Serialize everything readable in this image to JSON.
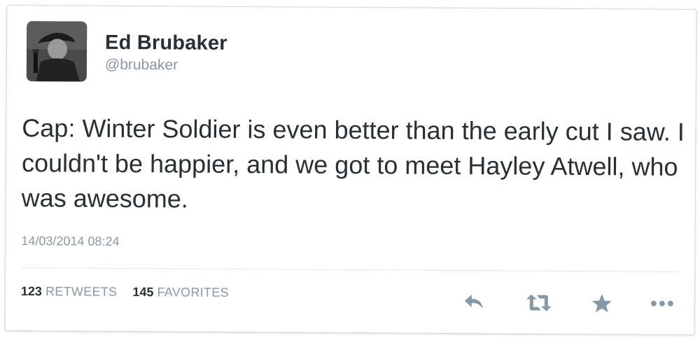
{
  "tweet": {
    "author": {
      "display_name": "Ed Brubaker",
      "handle": "@brubaker"
    },
    "text": "Cap: Winter Soldier is even better than the early cut I saw. I couldn't be happier, and we got to meet Hayley Atwell, who was awesome.",
    "timestamp": "14/03/2014 08:24",
    "stats": {
      "retweets_count": "123",
      "retweets_label": "RETWEETS",
      "favorites_count": "145",
      "favorites_label": "FAVORITES"
    },
    "actions": {
      "reply_icon": "reply-icon",
      "retweet_icon": "retweet-icon",
      "favorite_icon": "star-icon",
      "more_icon": "more-dots-icon"
    }
  },
  "colors": {
    "text_primary": "#292f33",
    "text_secondary": "#8899a6",
    "icon": "#8899a6",
    "divider": "#e1e8ed"
  }
}
